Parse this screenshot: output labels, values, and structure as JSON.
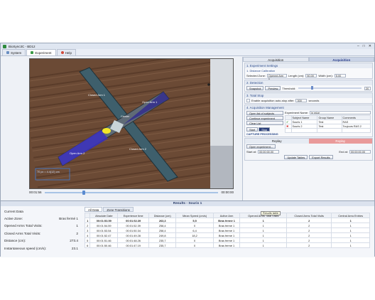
{
  "window": {
    "title": "BioSync3C - BD12"
  },
  "menu": {
    "system": "System",
    "experiment": "Experiment",
    "help": "Help"
  },
  "video": {
    "labels": [
      "Closed Arm 1",
      "Center",
      "Open Arm 1",
      "Open Arm 2",
      "Closed Arm 2"
    ],
    "scale": "70 px = 4.4(12) cm",
    "time_current": "00:01:56",
    "time_end": "00:00:00",
    "progress": 0.22
  },
  "right_panel": {
    "tabs": [
      "Acquisition",
      "Acquisition"
    ],
    "s1": {
      "title": "1. Experiment Settings",
      "sub": "1. Distance Calibration",
      "selected_zone": "Selected Zone:",
      "zone_value": "Opened Arm 1",
      "length_label": "Length (cm):",
      "length": "50.00",
      "width_label": "Width (cm):",
      "width": "5.00"
    },
    "s2": {
      "title": "2. Detection",
      "snapshot": "Snapshot",
      "preview": "Preview",
      "threshold": "Threshold:",
      "threshold_val": "20"
    },
    "s3": {
      "title": "3. Total Stop",
      "enable": "Enable acquisition auto-stop  after:",
      "stop_val": "300",
      "seconds": "seconds"
    },
    "s4": {
      "title": "4. Acquisition Management",
      "experiment_name_label": "Experiment Name:",
      "experiment_name": "in mice",
      "open_list": "Open list of subjects",
      "continue": "Continue experiment",
      "clear": "Clear List",
      "start": "Start",
      "stop": "Stop",
      "capture": "CAPTURE PROCESSING",
      "cols": [
        "Subject Name",
        "Group Name",
        "Comments"
      ],
      "subjects": [
        {
          "name": "Souris 1",
          "group": "Test",
          "comment": "RAS"
        },
        {
          "name": "Souris 2",
          "group": "Test",
          "comment": "Toujours RAS 2"
        }
      ]
    },
    "replay": {
      "left": "Replay",
      "right": "Replay",
      "open": "Open experiment...",
      "start_label": "Start at:",
      "start": "00:00:00.00",
      "end_label": "End at:",
      "end": "00:00:00.00",
      "update": "Update Tables",
      "export": "Export Results"
    }
  },
  "results": {
    "title": "Results - Souris 1",
    "current": [
      {
        "label": "Current Data",
        "value": ""
      },
      {
        "label": "Active Zone:",
        "value": "Bras fermé 1"
      },
      {
        "label": "Opened Arms Total Visits:",
        "value": "1"
      },
      {
        "label": "Closed Arms Total Visits:",
        "value": "2"
      },
      {
        "label": "Distance (cm):",
        "value": "273.4"
      },
      {
        "label": "Instantaneous speed (cm/s):",
        "value": "23.1"
      }
    ],
    "tabs": [
      "All Data",
      "Zone Transitions"
    ],
    "tooltip": "Results table",
    "columns": [
      "",
      "Absolute Date",
      "Experience time",
      "Distance (cm)",
      "Mean Speed (cm/s)",
      "Active Arm",
      "Opened Arms Total Visits",
      "Closed Arms Total Visits",
      "Central Area Entries"
    ],
    "rows": [
      [
        "1",
        "00:01:53.59",
        "00:01:52.39",
        "263,3",
        "5,5",
        "Bras fermé 1",
        "1",
        "2",
        "1"
      ],
      [
        "2",
        "00:01:54.59",
        "00:01:52.39",
        "258,4",
        "0",
        "Bras fermé 1",
        "1",
        "2",
        "1"
      ],
      [
        "3",
        "00:01:53.54",
        "00:01:50.34",
        "258,4",
        "6,4",
        "Bras fermé 1",
        "1",
        "2",
        "1"
      ],
      [
        "4",
        "00:01:52.47",
        "00:01:49.28",
        "249,8",
        "18,2",
        "Bras fermé 1",
        "1",
        "2",
        "1"
      ],
      [
        "5",
        "00:01:51.46",
        "00:01:48.26",
        "235,7",
        "0",
        "Bras fermé 1",
        "1",
        "2",
        "1"
      ],
      [
        "6",
        "00:01:50.46",
        "00:01:47.19",
        "235,7",
        "0",
        "Bras fermé 1",
        "1",
        "2",
        "1"
      ]
    ]
  }
}
